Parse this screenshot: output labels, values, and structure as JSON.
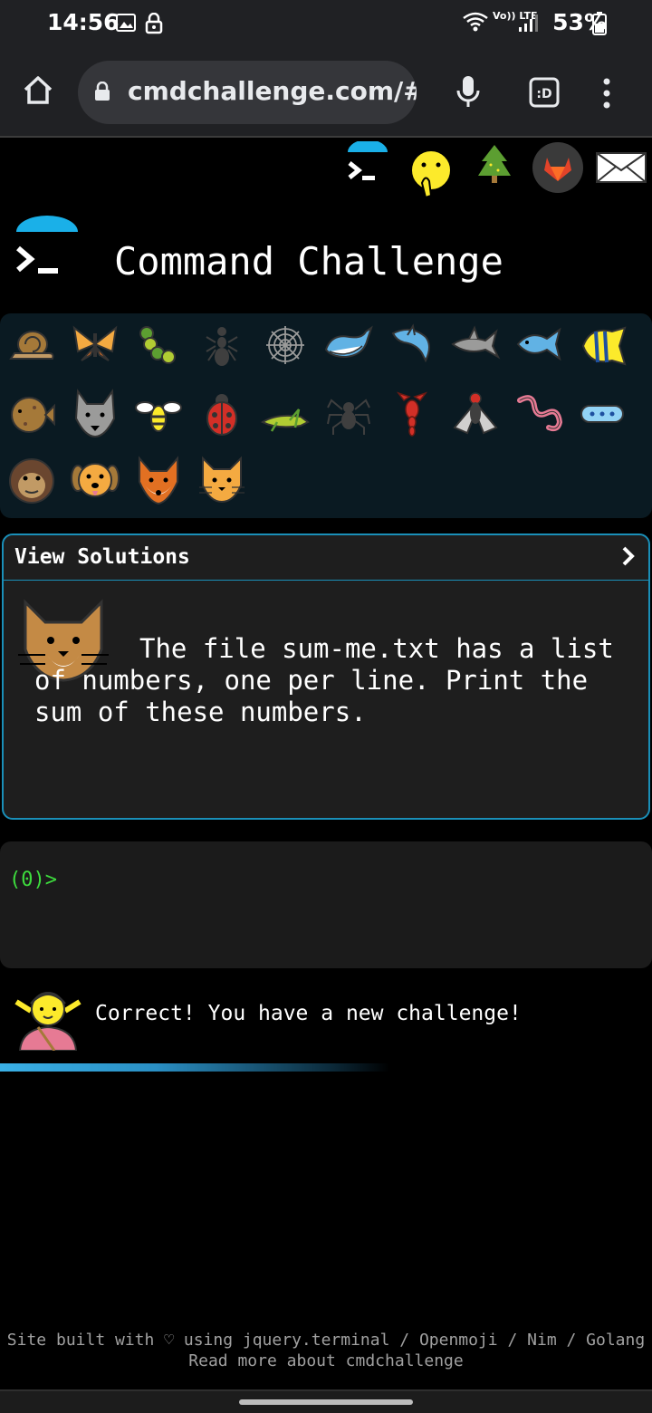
{
  "status_bar": {
    "time": "14:56",
    "network": "Vo)) LTE",
    "battery": "53%"
  },
  "browser": {
    "url": "cmdchallenge.com/#/",
    "icons": [
      "home-icon",
      "lock-icon",
      "mic-icon",
      "tab-switcher-icon",
      "more-icon"
    ]
  },
  "header_icons": [
    "terminal-logo-icon",
    "shushing-face-icon",
    "tree-icon",
    "gitlab-icon",
    "mail-icon"
  ],
  "title": "Command Challenge",
  "challenge_icons": [
    "snail-icon",
    "butterfly-icon",
    "caterpillar-icon",
    "ant-icon",
    "spider-web-icon",
    "whale-icon",
    "dolphin-icon",
    "shark-icon",
    "fish-icon",
    "tropical-fish-icon",
    "pufferfish-icon",
    "wolf-icon",
    "bee-icon",
    "ladybug-icon",
    "cricket-icon",
    "spider-icon",
    "scorpion-icon",
    "fly-icon",
    "worm-icon",
    "microbe-icon",
    "monkey-icon",
    "dog-icon",
    "fox-icon",
    "cat-icon"
  ],
  "solutions": {
    "header": "View Solutions",
    "challenge_text": "The file sum-me.txt has a list of numbers, one per line. Print the sum of these numbers."
  },
  "terminal": {
    "prompt": "(0)>"
  },
  "result": {
    "message": "Correct! You have a new challenge!",
    "progress": 0.6
  },
  "footer": {
    "line1": "Site built with ♡ using jquery.terminal / Openmoji / Nim / Golang",
    "line2": "Read more about cmdchallenge"
  },
  "colors": {
    "accent": "#1a8fb8",
    "prompt": "#3ddc3d",
    "grid_bg": "#0a1a22"
  }
}
